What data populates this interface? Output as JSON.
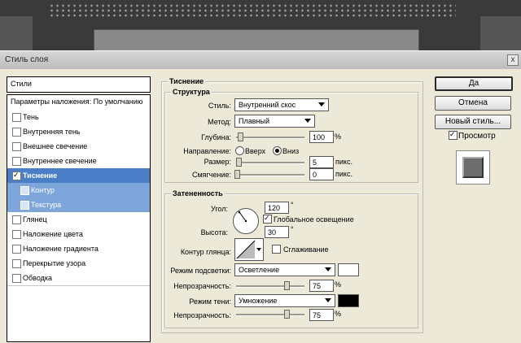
{
  "window": {
    "title": "Стиль слоя",
    "close_glyph": "x"
  },
  "sidebar": {
    "styles_label": "Стили",
    "blend_label": "Параметры наложения: По умолчанию",
    "items": [
      {
        "label": "Тень",
        "checked": false
      },
      {
        "label": "Внутренняя тень",
        "checked": false
      },
      {
        "label": "Внешнее свечение",
        "checked": false
      },
      {
        "label": "Внутреннее свечение",
        "checked": false
      },
      {
        "label": "Тиснение",
        "checked": true
      },
      {
        "label": "Контур",
        "checked": false
      },
      {
        "label": "Текстура",
        "checked": false
      },
      {
        "label": "Глянец",
        "checked": false
      },
      {
        "label": "Наложение цвета",
        "checked": false
      },
      {
        "label": "Наложение градиента",
        "checked": false
      },
      {
        "label": "Перекрытие узора",
        "checked": false
      },
      {
        "label": "Обводка",
        "checked": false
      }
    ]
  },
  "bevel": {
    "title": "Тиснение",
    "structure": {
      "title": "Структура",
      "style_label": "Стиль:",
      "style_value": "Внутренний скос",
      "technique_label": "Метод:",
      "technique_value": "Плавный",
      "depth_label": "Глубина:",
      "depth_value": "100",
      "depth_unit": "%",
      "direction_label": "Направление:",
      "direction_up": "Вверх",
      "direction_down": "Вниз",
      "size_label": "Размер:",
      "size_value": "5",
      "size_unit": "пикс.",
      "soften_label": "Смягчение:",
      "soften_value": "0",
      "soften_unit": "пикс."
    },
    "shading": {
      "title": "Затененность",
      "angle_label": "Угол:",
      "angle_value": "120",
      "angle_unit": "°",
      "global_light_label": "Глобальное освещение",
      "altitude_label": "Высота:",
      "altitude_value": "30",
      "altitude_unit": "°",
      "gloss_label": "Контур глянца:",
      "antialias_label": "Сглаживание",
      "highlight_mode_label": "Режим подсветки:",
      "highlight_mode_value": "Осветление",
      "highlight_color": "#ffffff",
      "highlight_opacity_label": "Непрозрачность:",
      "highlight_opacity_value": "75",
      "highlight_opacity_unit": "%",
      "shadow_mode_label": "Режим тени:",
      "shadow_mode_value": "Умножение",
      "shadow_color": "#000000",
      "shadow_opacity_label": "Непрозрачность:",
      "shadow_opacity_value": "75",
      "shadow_opacity_unit": "%"
    }
  },
  "buttons": {
    "ok": "Да",
    "cancel": "Отмена",
    "new_style": "Новый стиль...",
    "preview_label": "Просмотр"
  },
  "colors": {
    "selection": "#4a7fc8",
    "sub_selection": "#7ea6da"
  }
}
